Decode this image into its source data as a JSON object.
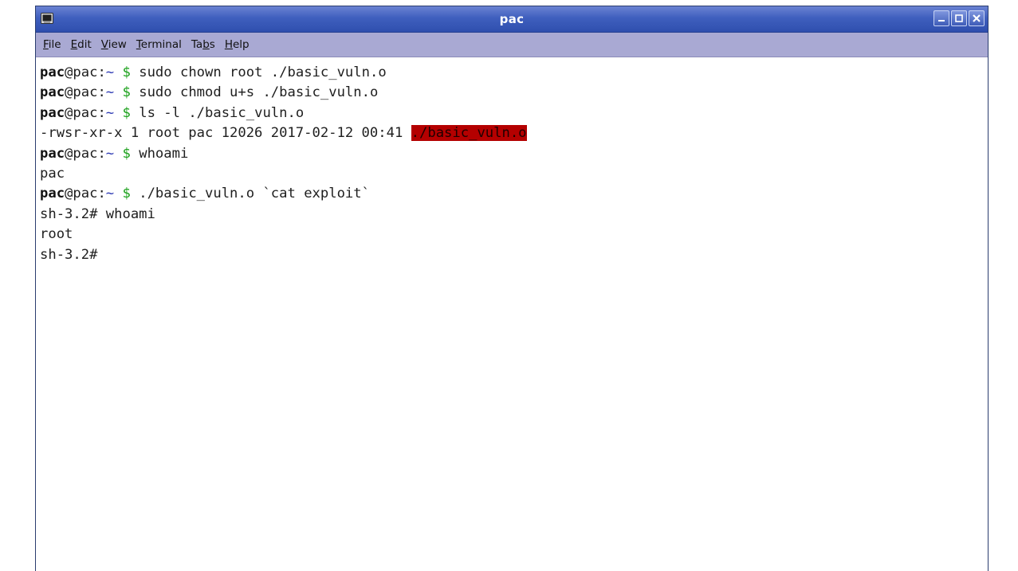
{
  "window": {
    "title": "pac",
    "controls": [
      "minimize",
      "maximize",
      "close"
    ]
  },
  "menu": {
    "items": [
      {
        "label": "File",
        "mnemonic": "F",
        "rest": "ile"
      },
      {
        "label": "Edit",
        "mnemonic": "E",
        "rest": "dit"
      },
      {
        "label": "View",
        "mnemonic": "V",
        "rest": "iew"
      },
      {
        "label": "Terminal",
        "mnemonic": "T",
        "rest": "erminal"
      },
      {
        "label": "Tabs",
        "pre": "Ta",
        "mnemonic": "b",
        "rest": "s"
      },
      {
        "label": "Help",
        "mnemonic": "H",
        "rest": "elp"
      }
    ]
  },
  "terminal": {
    "prompt": {
      "user": "pac",
      "at_host": "@pac:",
      "path": "~",
      "symbol": "$"
    },
    "lines": [
      {
        "type": "prompt",
        "command": "sudo chown root ./basic_vuln.o"
      },
      {
        "type": "prompt",
        "command": "sudo chmod u+s ./basic_vuln.o"
      },
      {
        "type": "prompt",
        "command": "ls -l ./basic_vuln.o"
      },
      {
        "type": "ls",
        "text": "-rwsr-xr-x 1 root pac 12026 2017-02-12 00:41 ",
        "highlight": "./basic_vuln.o"
      },
      {
        "type": "prompt",
        "command": "whoami"
      },
      {
        "type": "output",
        "text": "pac"
      },
      {
        "type": "prompt",
        "command": "./basic_vuln.o `cat exploit`"
      },
      {
        "type": "output",
        "text": "sh-3.2# whoami"
      },
      {
        "type": "output",
        "text": "root"
      },
      {
        "type": "output",
        "text": "sh-3.2#"
      }
    ]
  },
  "colors": {
    "titlebar": "#3f5fbe",
    "menubar": "#a9a9d3",
    "prompt_path": "#2e3bb4",
    "prompt_symbol": "#1aa01a",
    "highlight_bg": "#b40000"
  }
}
